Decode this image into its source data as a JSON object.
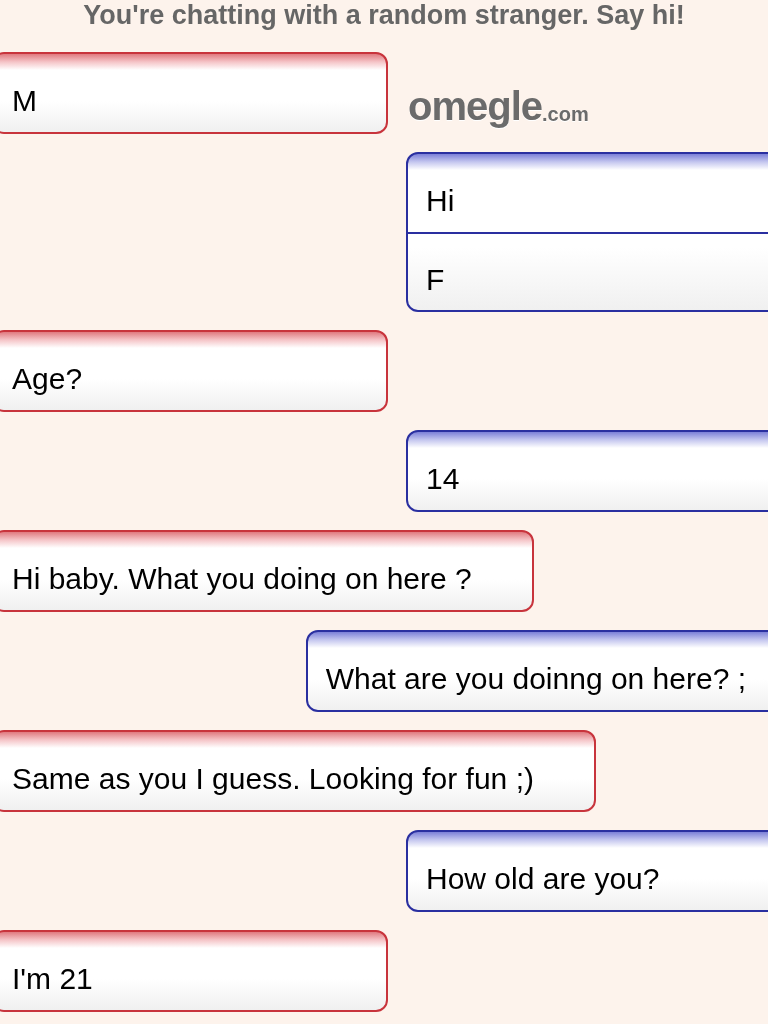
{
  "header": "You're chatting with a random stranger. Say hi!",
  "logo": {
    "name": "omegle",
    "suffix": ".com"
  },
  "messages": [
    {
      "kind": "stranger",
      "lines": [
        "M"
      ]
    },
    {
      "kind": "you",
      "lines": [
        "Hi",
        "F"
      ]
    },
    {
      "kind": "stranger",
      "lines": [
        "Age?"
      ]
    },
    {
      "kind": "you",
      "lines": [
        "14"
      ]
    },
    {
      "kind": "stranger",
      "lines": [
        "Hi baby. What you doing on here ?"
      ]
    },
    {
      "kind": "you",
      "lines": [
        "What are you doinng on here? ;"
      ]
    },
    {
      "kind": "stranger",
      "lines": [
        "Same as you I guess. Looking for fun ;)"
      ]
    },
    {
      "kind": "you",
      "lines": [
        "How old are you?"
      ]
    },
    {
      "kind": "stranger",
      "lines": [
        "I'm 21"
      ]
    }
  ]
}
